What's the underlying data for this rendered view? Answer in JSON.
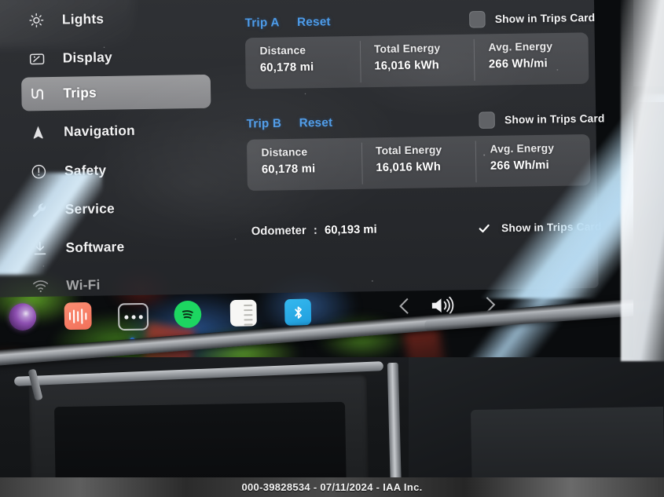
{
  "sidebar": {
    "items": [
      {
        "label": "Lights",
        "icon": "sun-icon",
        "active": false
      },
      {
        "label": "Display",
        "icon": "display-icon",
        "active": false
      },
      {
        "label": "Trips",
        "icon": "winding-road-icon",
        "active": true
      },
      {
        "label": "Navigation",
        "icon": "navigation-arrow-icon",
        "active": false
      },
      {
        "label": "Safety",
        "icon": "exclamation-circle-icon",
        "active": false
      },
      {
        "label": "Service",
        "icon": "wrench-icon",
        "active": false
      },
      {
        "label": "Software",
        "icon": "download-icon",
        "active": false
      },
      {
        "label": "Wi-Fi",
        "icon": "wifi-icon",
        "active": false
      }
    ]
  },
  "trips": {
    "trip_a": {
      "name": "Trip A",
      "reset_label": "Reset",
      "show_in_trips_card_label": "Show in Trips Card",
      "show_in_trips_card_checked": false,
      "stats": [
        {
          "key": "Distance",
          "value": "60,178 mi"
        },
        {
          "key": "Total Energy",
          "value": "16,016 kWh"
        },
        {
          "key": "Avg. Energy",
          "value": "266 Wh/mi"
        }
      ]
    },
    "trip_b": {
      "name": "Trip B",
      "reset_label": "Reset",
      "show_in_trips_card_label": "Show in Trips Card",
      "show_in_trips_card_checked": false,
      "stats": [
        {
          "key": "Distance",
          "value": "60,178 mi"
        },
        {
          "key": "Total Energy",
          "value": "16,016 kWh"
        },
        {
          "key": "Avg. Energy",
          "value": "266 Wh/mi"
        }
      ]
    },
    "odometer": {
      "label": "Odometer",
      "separator": ":",
      "value": "60,193 mi",
      "show_in_trips_card_label": "Show in Trips Card",
      "show_in_trips_card_checked": true
    }
  },
  "dock": {
    "items": [
      {
        "name": "camera-lens-icon"
      },
      {
        "name": "audio-waveform-icon"
      },
      {
        "name": "more-apps-icon"
      },
      {
        "name": "spotify-icon"
      },
      {
        "name": "notes-icon"
      },
      {
        "name": "bluetooth-icon"
      }
    ]
  },
  "media_controls": {
    "previous": "previous-track-icon",
    "volume": "volume-icon",
    "next": "next-track-icon"
  },
  "watermark": {
    "text": "000-39828534 - 07/11/2024 - IAA Inc."
  },
  "colors": {
    "accent_blue": "#4d9be8",
    "panel_bg": "#34363a",
    "card_bg": "#7d7e82",
    "spotify_green": "#1dd661",
    "bluetooth_blue": "#35b9ef",
    "dock_dot_blue": "#2f7ff0"
  }
}
